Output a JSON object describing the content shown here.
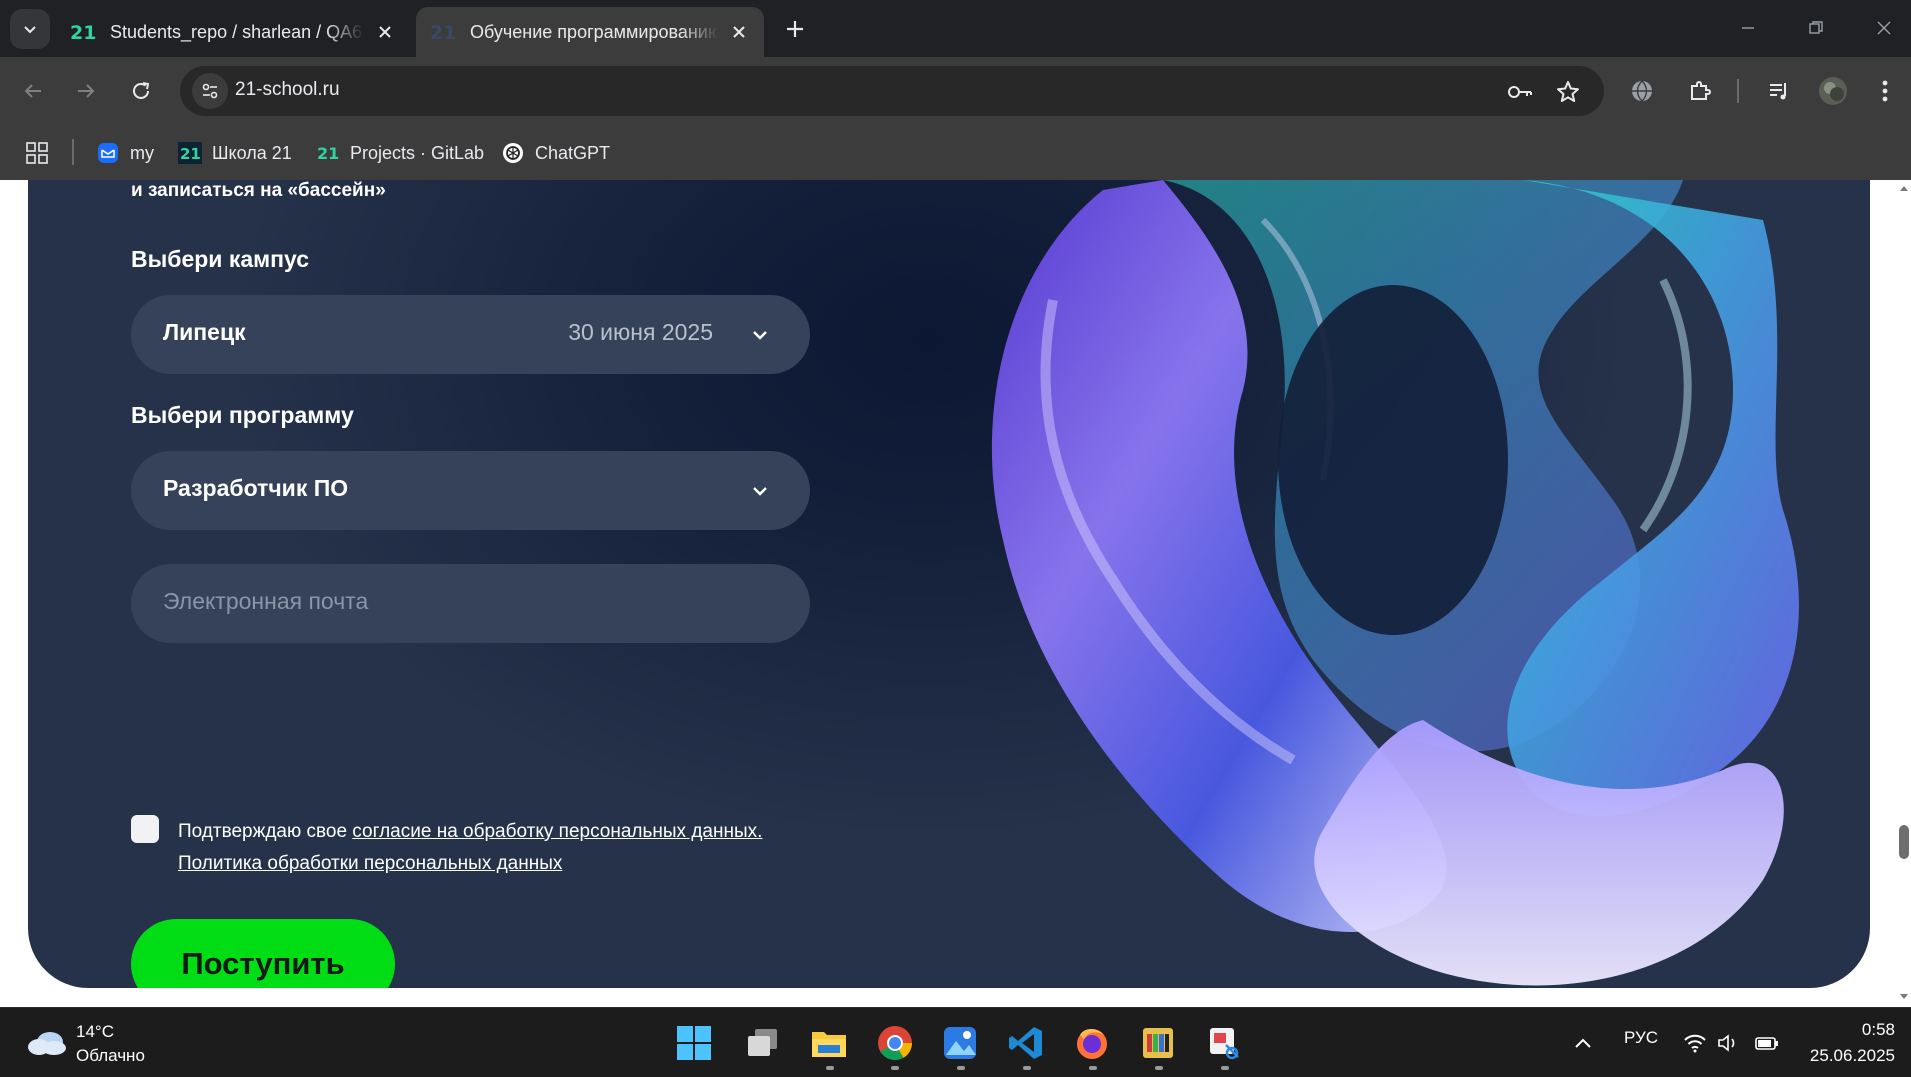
{
  "browser": {
    "tabs": [
      {
        "title": "Students_repo / sharlean / QA6",
        "active": false
      },
      {
        "title": "Обучение программированию",
        "active": true
      }
    ],
    "url": "21-school.ru",
    "bookmarks": [
      {
        "label": "my",
        "icon": "mail-icon"
      },
      {
        "label": "Школа 21",
        "icon": "school21-icon"
      },
      {
        "label": "Projects · GitLab",
        "icon": "school21-icon"
      },
      {
        "label": "ChatGPT",
        "icon": "chatgpt-icon"
      }
    ]
  },
  "form": {
    "lead_text": "и записаться на «бассейн»",
    "campus_label": "Выбери кампус",
    "campus_value": "Липецк",
    "campus_date": "30 июня 2025",
    "program_label": "Выбери программу",
    "program_value": "Разработчик ПО",
    "email_placeholder": "Электронная почта",
    "consent_prefix": "Подтверждаю свое ",
    "consent_link": "согласие на обработку персональных данных.",
    "policy_link": "Политика обработки персональных данных",
    "submit_label": "Поступить",
    "color_picker_hex": "293b53"
  },
  "colors": {
    "accent_green": "#00dd14",
    "card_background": "#293b53",
    "swatch": "#293b53"
  },
  "taskbar": {
    "weather_temp": "14°C",
    "weather_desc": "Облачно",
    "language": "РУС",
    "time": "0:58",
    "date": "25.06.2025",
    "apps": [
      "start-icon",
      "task-view-icon",
      "file-explorer-icon",
      "chrome-icon",
      "photos-icon",
      "vscode-icon",
      "firefox-icon",
      "terminal-app-icon",
      "snipping-tool-icon"
    ]
  }
}
